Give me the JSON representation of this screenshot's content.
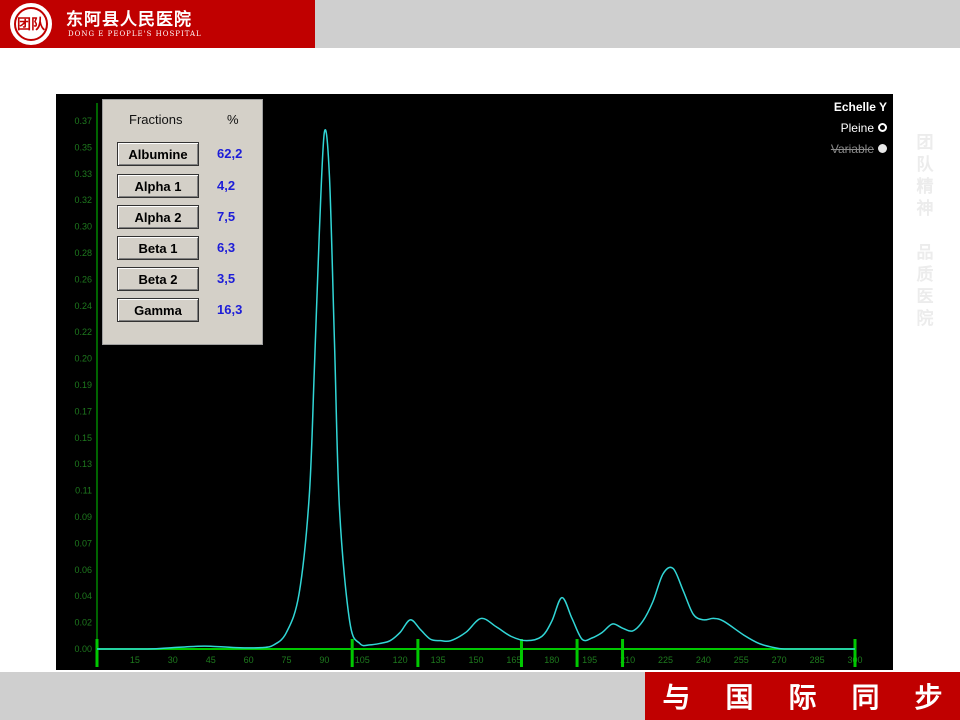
{
  "header": {
    "hospital_name": "东阿县人民医院",
    "hospital_en": "DONG E PEOPLE'S HOSPITAL",
    "seal_text": "团队"
  },
  "side_slogan": [
    "团",
    "队",
    "精",
    "神",
    "",
    "品",
    "质",
    "医",
    "院"
  ],
  "bottom_slogan": [
    "与",
    "国",
    "际",
    "同",
    "步"
  ],
  "colors": {
    "brand_red": "#c00000",
    "bar_gray": "#cfcfcf",
    "curve": "#31d6d6",
    "axis": "#00c800",
    "tick_label": "#1e7a1e",
    "fraction_value": "#1c1cd8"
  },
  "fractions_panel": {
    "header_name": "Fractions",
    "header_pct": "%",
    "rows": [
      {
        "name": "Albumine",
        "value": "62,2"
      },
      {
        "name": "Alpha 1",
        "value": "4,2"
      },
      {
        "name": "Alpha 2",
        "value": "7,5"
      },
      {
        "name": "Beta 1",
        "value": "6,3"
      },
      {
        "name": "Beta 2",
        "value": "3,5"
      },
      {
        "name": "Gamma",
        "value": "16,3"
      }
    ]
  },
  "echelle": {
    "title": "Echelle Y",
    "option_full": "Pleine",
    "option_variable": "Variable",
    "selected": "Pleine"
  },
  "chart_data": {
    "type": "line",
    "title": "",
    "xlabel": "",
    "ylabel": "",
    "xlim": [
      0,
      300
    ],
    "ylim": [
      0,
      0.38
    ],
    "grid": false,
    "y_ticks": [
      "0.00",
      "0.02",
      "0.04",
      "0.06",
      "0.07",
      "0.09",
      "0.11",
      "0.13",
      "0.15",
      "0.17",
      "0.19",
      "0.20",
      "0.22",
      "0.24",
      "0.26",
      "0.28",
      "0.30",
      "0.32",
      "0.33",
      "0.35",
      "0.37"
    ],
    "x_ticks": [
      "15",
      "30",
      "45",
      "60",
      "75",
      "90",
      "105",
      "120",
      "135",
      "150",
      "165",
      "180",
      "195",
      "210",
      "225",
      "240",
      "255",
      "270",
      "285",
      "300"
    ],
    "fraction_boundaries_x": [
      0,
      101,
      127,
      168,
      190,
      208,
      300
    ],
    "series": [
      {
        "x": [
          0,
          20,
          30,
          40,
          45,
          55,
          65,
          70,
          75,
          80,
          84,
          86,
          88,
          90,
          92,
          94,
          96,
          100,
          104,
          108,
          112,
          116,
          120,
          124,
          128,
          132,
          136,
          140,
          146,
          152,
          158,
          164,
          170,
          176,
          180,
          184,
          188,
          192,
          196,
          200,
          204,
          208,
          212,
          216,
          220,
          224,
          228,
          232,
          236,
          240,
          244,
          248,
          256,
          262,
          268,
          272,
          280,
          290,
          300
        ],
        "y": [
          0,
          0,
          0.001,
          0.002,
          0.002,
          0.001,
          0.001,
          0.003,
          0.012,
          0.04,
          0.11,
          0.2,
          0.3,
          0.372,
          0.34,
          0.22,
          0.1,
          0.02,
          0.004,
          0.003,
          0.004,
          0.006,
          0.012,
          0.021,
          0.014,
          0.007,
          0.006,
          0.006,
          0.012,
          0.022,
          0.016,
          0.009,
          0.006,
          0.009,
          0.02,
          0.037,
          0.022,
          0.007,
          0.008,
          0.012,
          0.018,
          0.015,
          0.013,
          0.02,
          0.034,
          0.054,
          0.058,
          0.042,
          0.025,
          0.021,
          0.022,
          0.02,
          0.01,
          0.004,
          0.001,
          0.0,
          0,
          0,
          0
        ]
      }
    ]
  }
}
